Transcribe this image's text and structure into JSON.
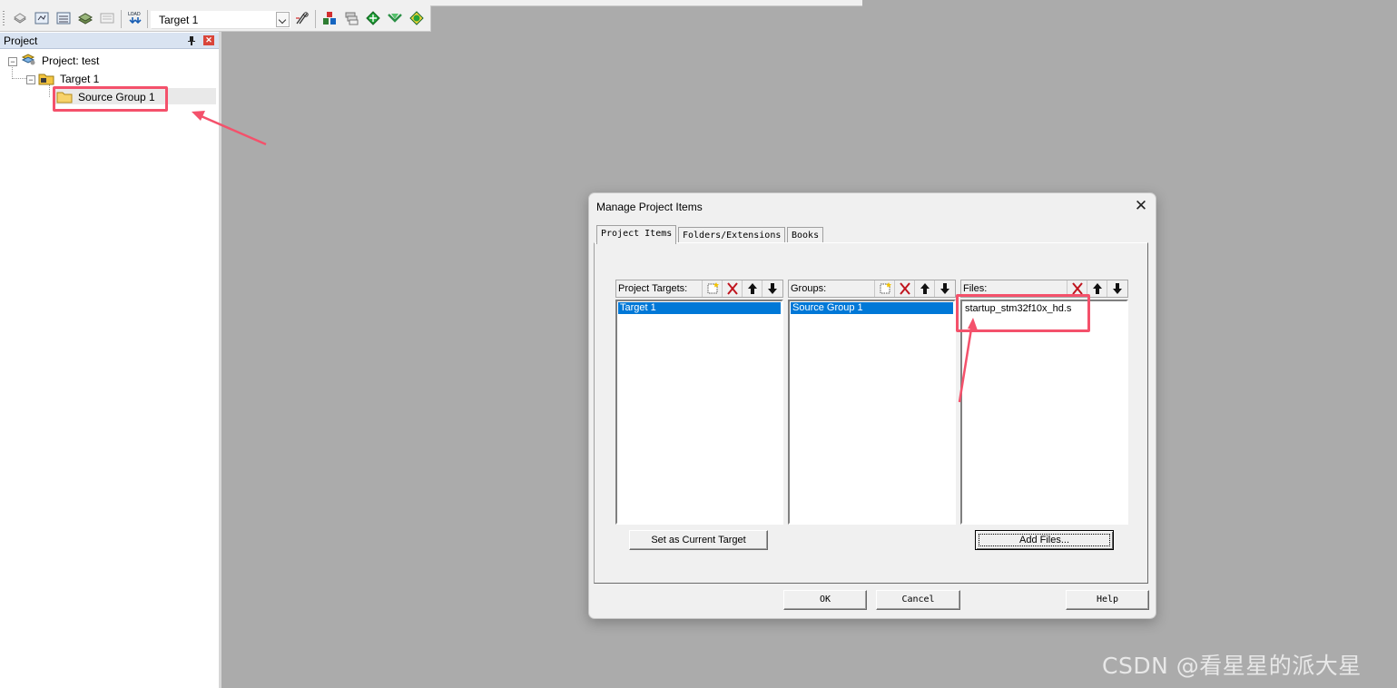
{
  "toolbar": {
    "target_value": "Target 1",
    "icons": [
      "translate-icon",
      "build-icon",
      "rebuild-icon",
      "batch-build-icon",
      "stop-build-icon",
      "load-icon",
      "options-icon",
      "manage-components-icon",
      "select-packs-icon",
      "pack-installer-icon",
      "run-time-environment-icon",
      "debug-icon"
    ]
  },
  "project_panel": {
    "title": "Project",
    "tree": {
      "root_label": "Project: test",
      "target_label": "Target 1",
      "group_label": "Source Group 1"
    }
  },
  "dialog": {
    "title": "Manage Project Items",
    "tabs": [
      {
        "label": "Project Items",
        "active": true
      },
      {
        "label": "Folders/Extensions",
        "active": false
      },
      {
        "label": "Books",
        "active": false
      }
    ],
    "targets": {
      "header": "Project Targets:",
      "items": [
        "Target 1"
      ],
      "selected": "Target 1"
    },
    "groups": {
      "header": "Groups:",
      "items": [
        "Source Group 1"
      ],
      "selected": "Source Group 1"
    },
    "files": {
      "header": "Files:",
      "items": [
        "startup_stm32f10x_hd.s"
      ]
    },
    "set_target_button": "Set as Current Target",
    "add_files_button": "Add Files...",
    "ok_button": "OK",
    "cancel_button": "Cancel",
    "help_button": "Help"
  },
  "watermark": "CSDN @看星星的派大星",
  "colors": {
    "annotation": "#f4516b",
    "selection": "#0078d7",
    "workspace": "#ababab"
  }
}
